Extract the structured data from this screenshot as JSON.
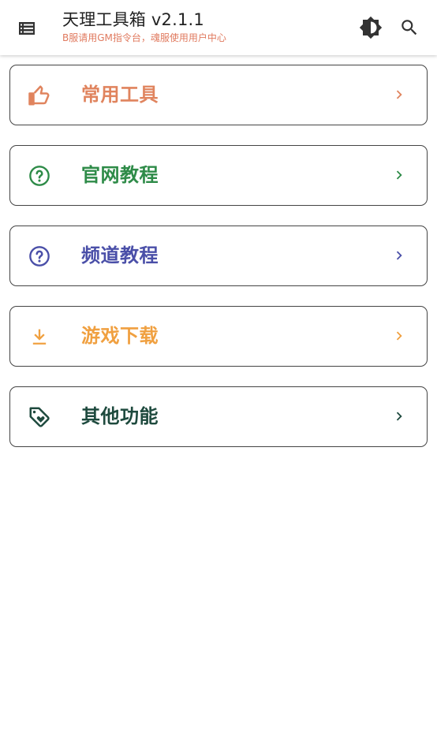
{
  "appbar": {
    "title": "天理工具箱 v2.1.1",
    "subtitle": "B服请用GM指令台，魂服使用用户中心",
    "menu_icon": "list-menu-icon",
    "theme_icon": "brightness-icon",
    "search_icon": "search-icon"
  },
  "cards": [
    {
      "label": "常用工具",
      "icon": "thumb-up-icon",
      "color": "#e0845e"
    },
    {
      "label": "官网教程",
      "icon": "help-circle-icon",
      "color": "#2e8b48"
    },
    {
      "label": "频道教程",
      "icon": "help-circle-icon",
      "color": "#4a4fa8"
    },
    {
      "label": "游戏下载",
      "icon": "download-icon",
      "color": "#f0a040"
    },
    {
      "label": "其他功能",
      "icon": "tag-heart-icon",
      "color": "#1e4a3e"
    }
  ]
}
